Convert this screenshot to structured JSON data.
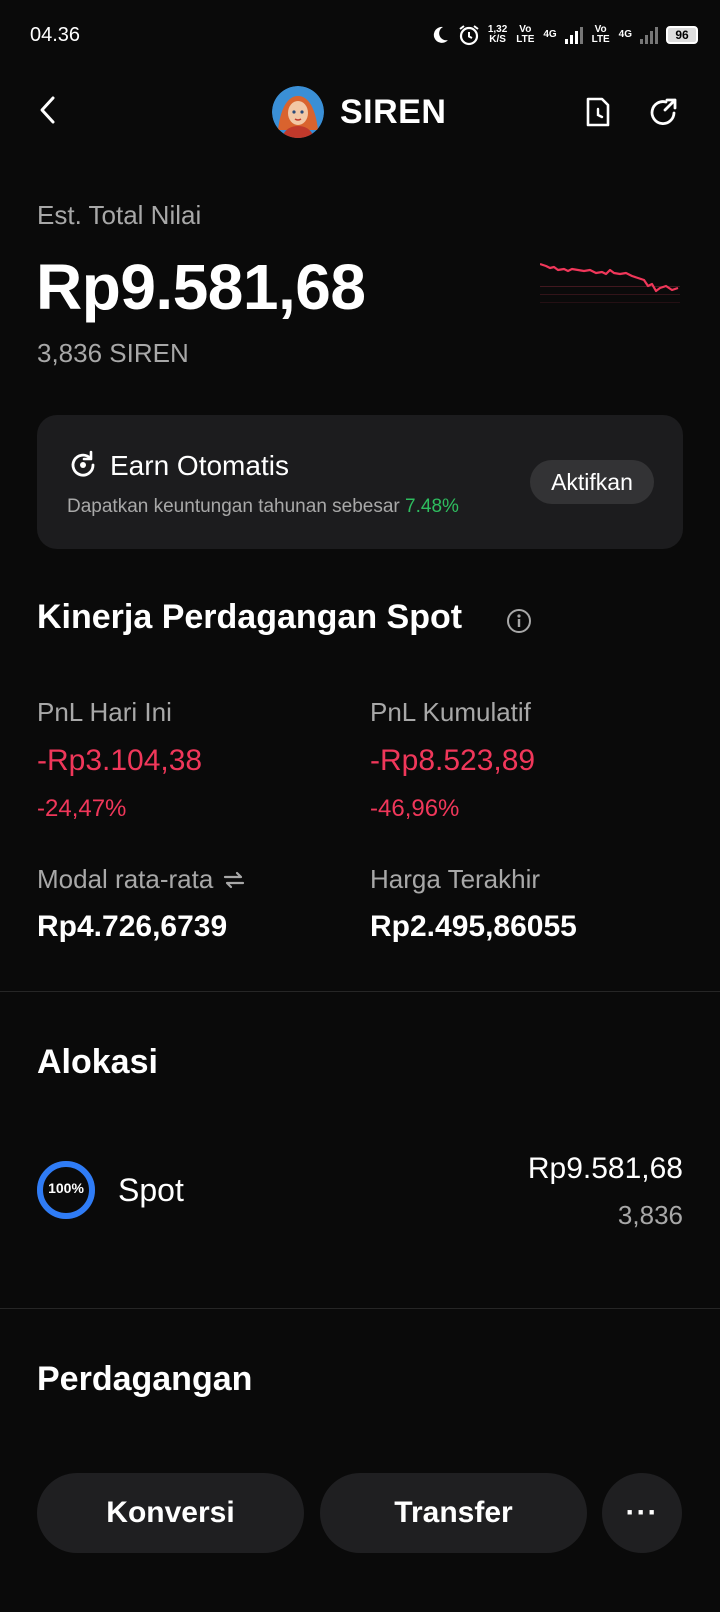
{
  "status_bar": {
    "time": "04.36",
    "net_speed_value": "1,32",
    "net_speed_unit": "K/S",
    "sim1_label": "Vo LTE",
    "sim1_net": "4G",
    "sim2_label": "Vo LTE",
    "sim2_net": "4G",
    "battery": "96"
  },
  "header": {
    "token_name": "SIREN",
    "back_icon": "chevron-left-icon",
    "history_icon": "document-clock-icon",
    "share_icon": "share-arrow-icon"
  },
  "summary": {
    "label": "Est. Total Nilai",
    "total_value": "Rp9.581,68",
    "token_amount": "3,836 SIREN",
    "sparkline_color": "#f0375a"
  },
  "earn": {
    "title": "Earn Otomatis",
    "description": "Dapatkan keuntungan tahunan sebesar",
    "rate": "7.48%",
    "button_label": "Aktifkan"
  },
  "performance": {
    "title": "Kinerja Perdagangan Spot",
    "pnl_today_label": "PnL Hari Ini",
    "pnl_today_value": "-Rp3.104,38",
    "pnl_today_pct": "-24,47%",
    "pnl_cumulative_label": "PnL Kumulatif",
    "pnl_cumulative_value": "-Rp8.523,89",
    "pnl_cumulative_pct": "-46,96%",
    "avg_cost_label": "Modal rata-rata",
    "avg_cost_value": "Rp4.726,6739",
    "last_price_label": "Harga Terakhir",
    "last_price_value": "Rp2.495,86055"
  },
  "allocation": {
    "title": "Alokasi",
    "items": [
      {
        "percent": "100%",
        "percent_value": 1.0,
        "name": "Spot",
        "value": "Rp9.581,68",
        "amount": "3,836",
        "color": "#2f7cf6"
      }
    ]
  },
  "trading": {
    "title": "Perdagangan",
    "convert_label": "Konversi",
    "transfer_label": "Transfer",
    "more_label": "···"
  }
}
